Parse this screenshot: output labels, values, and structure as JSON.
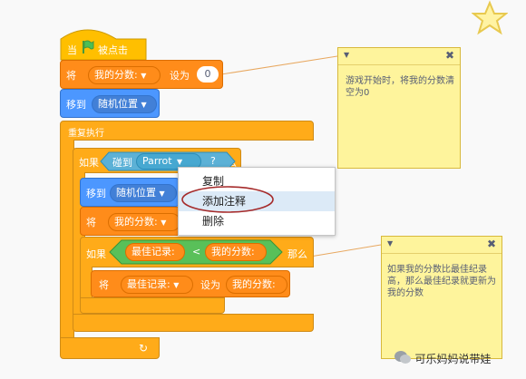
{
  "blocks": {
    "hat_when": "当",
    "hat_clicked": "被点击",
    "set_label": "将",
    "set_var": "我的分数:",
    "set_to": "设为",
    "set_value": "0",
    "goto_label": "移到",
    "goto_target": "随机位置",
    "forever_label": "重复执行",
    "if_label": "如果",
    "if_then": "那么",
    "touching_label": "碰到",
    "touching_target": "Parrot",
    "touching_q": "?",
    "inner_goto_label": "移到",
    "inner_goto_target": "随机位置",
    "inner_set_label": "将",
    "inner_set_var": "我的分数:",
    "if2_label": "如果",
    "if2_then": "那么",
    "best_score": "最佳记录:",
    "lt": "<",
    "my_score": "我的分数:",
    "set2_label": "将",
    "set2_var": "最佳记录:",
    "set2_to": "设为",
    "set2_value": "我的分数:"
  },
  "context_menu": {
    "items": [
      "复制",
      "添加注释",
      "删除"
    ]
  },
  "notes": [
    {
      "text": "游戏开始时，将我的分数清空为0"
    },
    {
      "text": "如果我的分数比最佳纪录高，那么最佳纪录就更新为我的分数"
    }
  ],
  "watermark": "可乐妈妈说带娃",
  "colors": {
    "events": "#FFBF00",
    "variables": "#FF8C1A",
    "control": "#FFAB19",
    "motion": "#4C97FF",
    "sensing": "#5CB1D6",
    "operators": "#59C059",
    "note": "#FEF49C"
  }
}
